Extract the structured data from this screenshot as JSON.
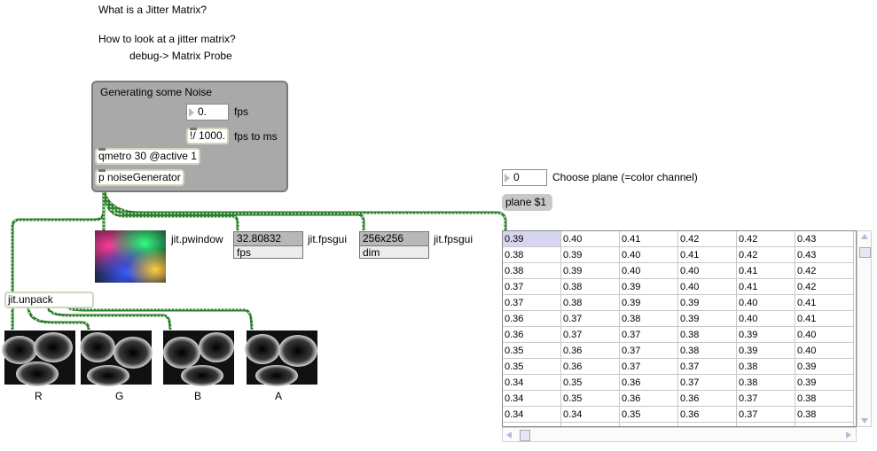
{
  "comments": {
    "title": "What is a Jitter Matrix?",
    "howto": "How to look at a jitter matrix?",
    "debug": "debug-> Matrix Probe",
    "fps": "fps",
    "fps_to_ms": "fps to ms",
    "pwindow": "jit.pwindow",
    "fpsgui1": "jit.fpsgui",
    "fpsgui2": "jit.fpsgui",
    "choose_plane": "Choose plane (=color channel)"
  },
  "subpatch": {
    "title": "Generating some Noise",
    "fps_value": "0.",
    "divide": "!/ 1000.",
    "qmetro": "qmetro 30 @active 1",
    "generator": "p noiseGenerator"
  },
  "fpsgui": [
    {
      "value": "32.80832",
      "mode": "fps"
    },
    {
      "value": "256x256",
      "mode": "dim"
    }
  ],
  "unpack": "jit.unpack",
  "channels": [
    "R",
    "G",
    "B",
    "A"
  ],
  "plane_number": "0",
  "plane_message": "plane $1",
  "matrix_rows": [
    [
      "0.39",
      "0.40",
      "0.41",
      "0.42",
      "0.42",
      "0.43"
    ],
    [
      "0.38",
      "0.39",
      "0.40",
      "0.41",
      "0.42",
      "0.43"
    ],
    [
      "0.38",
      "0.39",
      "0.40",
      "0.40",
      "0.41",
      "0.42"
    ],
    [
      "0.37",
      "0.38",
      "0.39",
      "0.40",
      "0.41",
      "0.42"
    ],
    [
      "0.37",
      "0.38",
      "0.39",
      "0.39",
      "0.40",
      "0.41"
    ],
    [
      "0.36",
      "0.37",
      "0.38",
      "0.39",
      "0.40",
      "0.41"
    ],
    [
      "0.36",
      "0.37",
      "0.37",
      "0.38",
      "0.39",
      "0.40"
    ],
    [
      "0.35",
      "0.36",
      "0.37",
      "0.38",
      "0.39",
      "0.40"
    ],
    [
      "0.35",
      "0.36",
      "0.37",
      "0.37",
      "0.38",
      "0.39"
    ],
    [
      "0.34",
      "0.35",
      "0.36",
      "0.37",
      "0.38",
      "0.39"
    ],
    [
      "0.34",
      "0.35",
      "0.36",
      "0.36",
      "0.37",
      "0.38"
    ],
    [
      "0.34",
      "0.34",
      "0.35",
      "0.36",
      "0.37",
      "0.38"
    ]
  ],
  "colors": {
    "patch_cord": "#3a8a3a",
    "subpatch_bg": "#a9a9a9",
    "selected_cell": "#d6d6f0"
  }
}
